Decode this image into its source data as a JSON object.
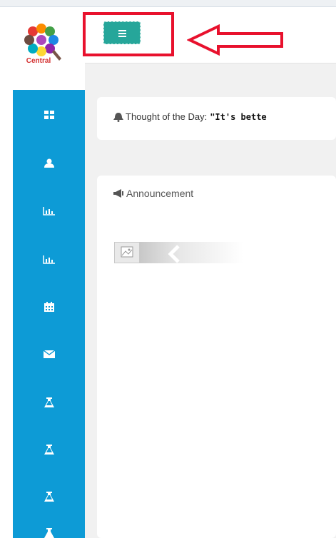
{
  "header": {
    "logo_text": "Central",
    "menu_icon": "hamburger-icon"
  },
  "annotation": {
    "box_color": "#e8112d",
    "arrow_direction": "left"
  },
  "sidebar": {
    "color": "#0d9bd6",
    "items": [
      {
        "icon": "dashboard-icon"
      },
      {
        "icon": "user-icon"
      },
      {
        "icon": "bar-chart-icon"
      },
      {
        "icon": "bar-chart-icon"
      },
      {
        "icon": "calendar-icon"
      },
      {
        "icon": "envelope-icon"
      },
      {
        "icon": "flask-icon"
      },
      {
        "icon": "flask-icon"
      },
      {
        "icon": "flask-icon"
      },
      {
        "icon": "flask-icon"
      }
    ]
  },
  "thought": {
    "label": "Thought of the Day:",
    "quote": "\"It's bette"
  },
  "announcement": {
    "title": "Announcement"
  }
}
